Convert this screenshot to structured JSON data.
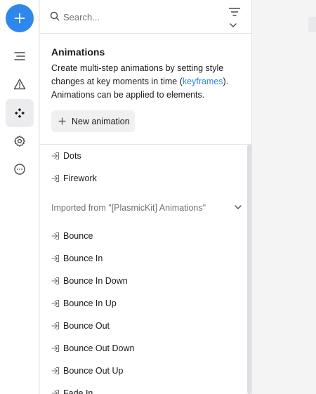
{
  "search": {
    "placeholder": "Search..."
  },
  "section": {
    "title": "Animations",
    "description_before": "Create multi-step animations by setting style changes at key moments in time (",
    "description_link": "keyframes",
    "description_after": "). Animations can be applied to elements."
  },
  "new_button_label": "New animation",
  "items": [
    "Dots",
    "Firework"
  ],
  "imported_group": {
    "label": "Imported from \"[PlasmicKit] Animations\"",
    "items": [
      "Bounce",
      "Bounce In",
      "Bounce In Down",
      "Bounce In Up",
      "Bounce Out",
      "Bounce Out Down",
      "Bounce Out Up",
      "Fade In"
    ]
  },
  "colors": {
    "accent": "#2f86ec",
    "link": "#2f86ec",
    "active_bg": "#ececee"
  },
  "icons": {
    "rail": [
      "plus-icon",
      "outline-icon",
      "warning-icon",
      "components-icon",
      "settings-icon",
      "more-icon"
    ],
    "item": "animation-enter-icon"
  }
}
